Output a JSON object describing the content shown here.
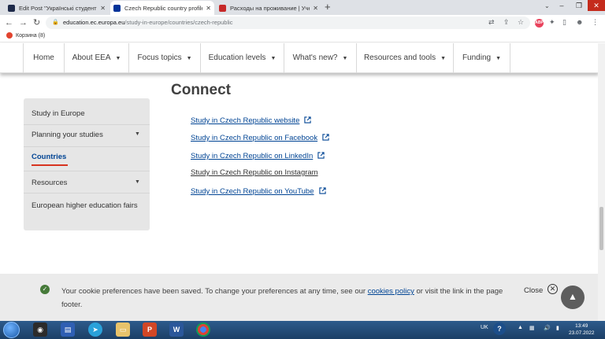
{
  "browser": {
    "tabs": [
      {
        "title": "Edit Post \"Українські студенти за",
        "icon_color": "#1e2a4a",
        "active": false
      },
      {
        "title": "Czech Republic country profile |",
        "icon_color": "#003399",
        "active": true
      },
      {
        "title": "Расходы на проживание | Учеба",
        "icon_color": "#c62828",
        "active": false
      }
    ],
    "new_tab": "+",
    "url_host": "education.ec.europa.eu",
    "url_path": "/study-in-europe/countries/czech-republic",
    "bookmark": "Корзина (8)"
  },
  "nav": {
    "items": [
      "Home",
      "About EEA",
      "Focus topics",
      "Education levels",
      "What's new?",
      "Resources and tools",
      "Funding"
    ]
  },
  "sidebar": {
    "items": [
      "Study in Europe",
      "Planning your studies",
      "Countries",
      "Resources",
      "European higher education fairs"
    ]
  },
  "connect": {
    "title": "Connect",
    "links": [
      "Study in Czech Republic website",
      "Study in Czech Republic on Facebook",
      "Study in Czech Republic on LinkedIn",
      "Study in Czech Republic on Instagram",
      "Study in Czech Republic on YouTube"
    ]
  },
  "cookie": {
    "text_before": "Your cookie preferences have been saved. To change your preferences at any time, see our",
    "link": "cookies policy",
    "text_after": "or visit the link in the page footer.",
    "close_label": "Close"
  },
  "taskbar": {
    "lang": "UK",
    "time": "13:49",
    "date": "23.07.2022"
  }
}
